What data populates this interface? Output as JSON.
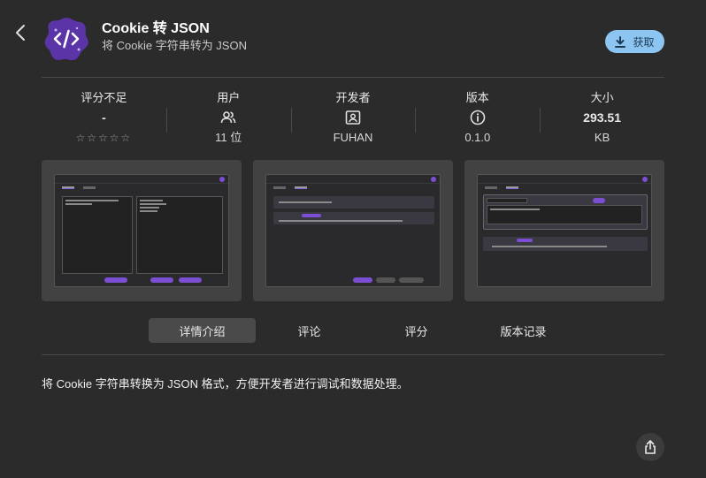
{
  "app": {
    "title": "Cookie 转 JSON",
    "subtitle": "将 Cookie 字符串转为 JSON",
    "icon": "code-brackets-icon",
    "icon_color": "#5b34a8"
  },
  "get_button": {
    "label": "获取",
    "icon": "download-icon",
    "color": "#8cc5f2"
  },
  "stats": [
    {
      "label": "评分不足",
      "main": "-",
      "sub": "☆☆☆☆☆",
      "rating_stars_filled": 0,
      "rating_stars_total": 5
    },
    {
      "label": "用户",
      "icon": "users-icon",
      "sub": "11 位"
    },
    {
      "label": "开发者",
      "icon": "developer-badge-icon",
      "sub": "FUHAN"
    },
    {
      "label": "版本",
      "icon": "info-icon",
      "sub": "0.1.0"
    },
    {
      "label": "大小",
      "main": "293.51",
      "sub": "KB"
    }
  ],
  "tabs": [
    {
      "label": "详情介绍",
      "active": true
    },
    {
      "label": "评论",
      "active": false
    },
    {
      "label": "评分",
      "active": false
    },
    {
      "label": "版本记录",
      "active": false
    }
  ],
  "description": "将 Cookie 字符串转换为 JSON 格式，方便开发者进行调试和数据处理。",
  "accent_color": "#7b4fd1"
}
